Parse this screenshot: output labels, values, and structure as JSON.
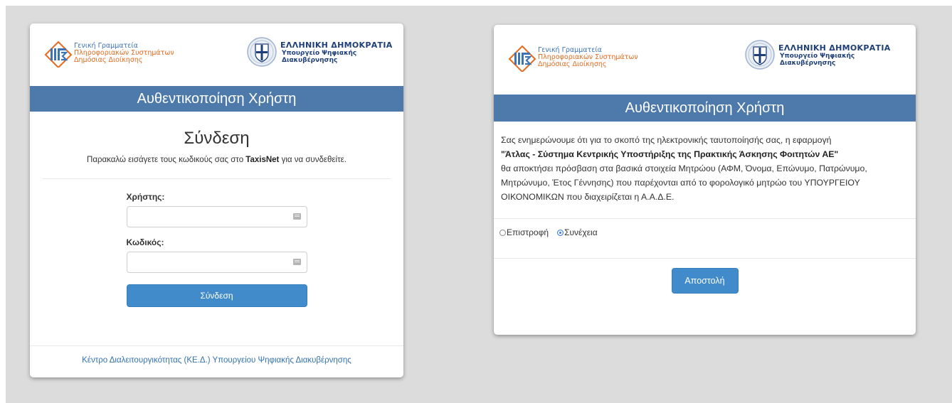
{
  "logos": {
    "gsis_line1": "Γενική Γραμματεία",
    "gsis_line2": "Πληροφοριακών Συστημάτων",
    "gsis_line3": "Δημόσιας Διοίκησης",
    "hr_title": "ΕΛΛΗΝΙΚΗ ΔΗΜΟΚΡΑΤΙΑ",
    "hr_line1": "Υπουργείο Ψηφιακής",
    "hr_line2": "Διακυβέρνησης"
  },
  "colors": {
    "bar": "#4e7aab",
    "primary_button": "#428bca",
    "link": "#3372b0",
    "gsis_blue": "#3d74b5",
    "gsis_orange": "#e86a1e"
  },
  "login": {
    "bar_title": "Αυθεντικοποίηση Χρήστη",
    "heading": "Σύνδεση",
    "subtitle_before": "Παρακαλώ εισάγετε τους κωδικούς σας στο",
    "subtitle_brand": "TaxisNet",
    "subtitle_after": "για να συνδεθείτε.",
    "user_label": "Χρήστης:",
    "password_label": "Κωδικός:",
    "user_value": "",
    "password_value": "",
    "submit_label": "Σύνδεση",
    "footer_link": "Κέντρο Διαλειτουργικότητας (ΚΕ.Δ.) Υπουργείου Ψηφιακής Διακυβέρνησης"
  },
  "consent": {
    "bar_title": "Αυθεντικοποίηση Χρήστη",
    "text_intro": "Σας ενημερώνουμε ότι για το σκοπό της ηλεκτρονικής ταυτοποίησής σας, η εφαρμογή",
    "app_name": "\"Άτλας - Σύστημα Κεντρικής Υποστήριξης της Πρακτικής Άσκησης Φοιτητών ΑΕ\"",
    "text_rest": "θα αποκτήσει πρόσβαση στα βασικά στοιχεία Μητρώου (ΑΦΜ, Όνομα, Επώνυμο, Πατρώνυμο, Μητρώνυμο, Έτος Γέννησης) που παρέχονται από το φορολογικό μητρώο του ΥΠΟΥΡΓΕΙΟΥ ΟΙΚΟΝΟΜΙΚΩΝ που διαχειρίζεται η Α.Α.Δ.Ε.",
    "option_back": "Επιστροφή",
    "option_continue": "Συνέχεια",
    "selected": "Συνέχεια",
    "submit_label": "Αποστολή"
  }
}
